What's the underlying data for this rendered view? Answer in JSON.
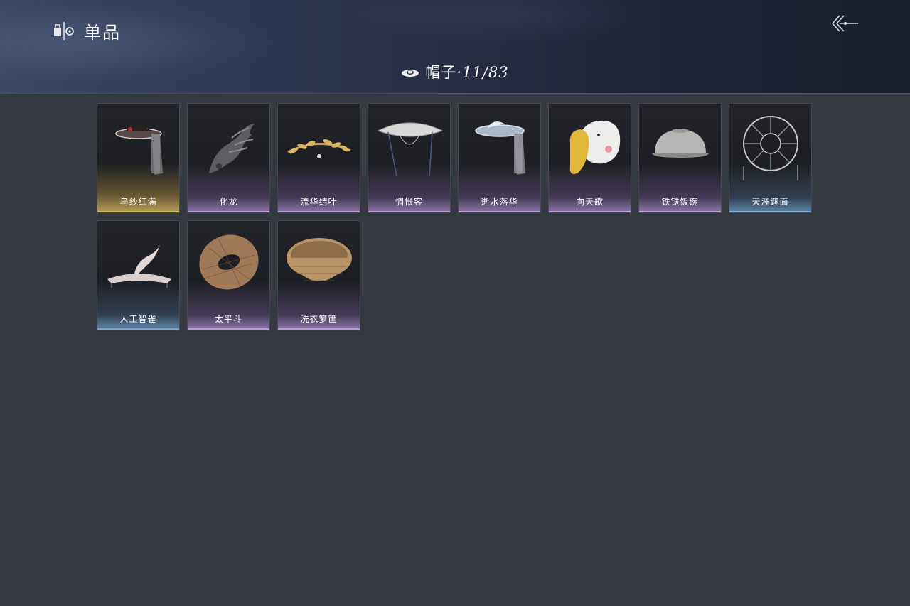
{
  "header": {
    "title": "单品",
    "title_icon": "wardrobe-icon",
    "back_icon": "back-arrow-icon"
  },
  "category": {
    "icon": "hat-icon",
    "label": "帽子",
    "separator": "·",
    "count": "11/83"
  },
  "items": [
    {
      "name": "乌纱红满",
      "rarity": "gold",
      "icon": "black-veil-hat"
    },
    {
      "name": "化龙",
      "rarity": "purple",
      "icon": "dragon-headpiece"
    },
    {
      "name": "流华结叶",
      "rarity": "purple",
      "icon": "golden-leaf-circlet"
    },
    {
      "name": "惆怅客",
      "rarity": "purple",
      "icon": "white-bamboo-hat"
    },
    {
      "name": "逝水落华",
      "rarity": "purple",
      "icon": "veil-bamboo-hat"
    },
    {
      "name": "向天歌",
      "rarity": "purple",
      "icon": "duck-hood"
    },
    {
      "name": "铁铁饭碗",
      "rarity": "purple",
      "icon": "iron-bowl-hat"
    },
    {
      "name": "天涯遮面",
      "rarity": "blue",
      "icon": "open-frame-hat"
    },
    {
      "name": "人工智雀",
      "rarity": "blue",
      "icon": "bird-hat"
    },
    {
      "name": "太平斗",
      "rarity": "purple",
      "icon": "woven-basket-hat"
    },
    {
      "name": "洗衣箩筐",
      "rarity": "purple",
      "icon": "laundry-basket-hat"
    }
  ]
}
